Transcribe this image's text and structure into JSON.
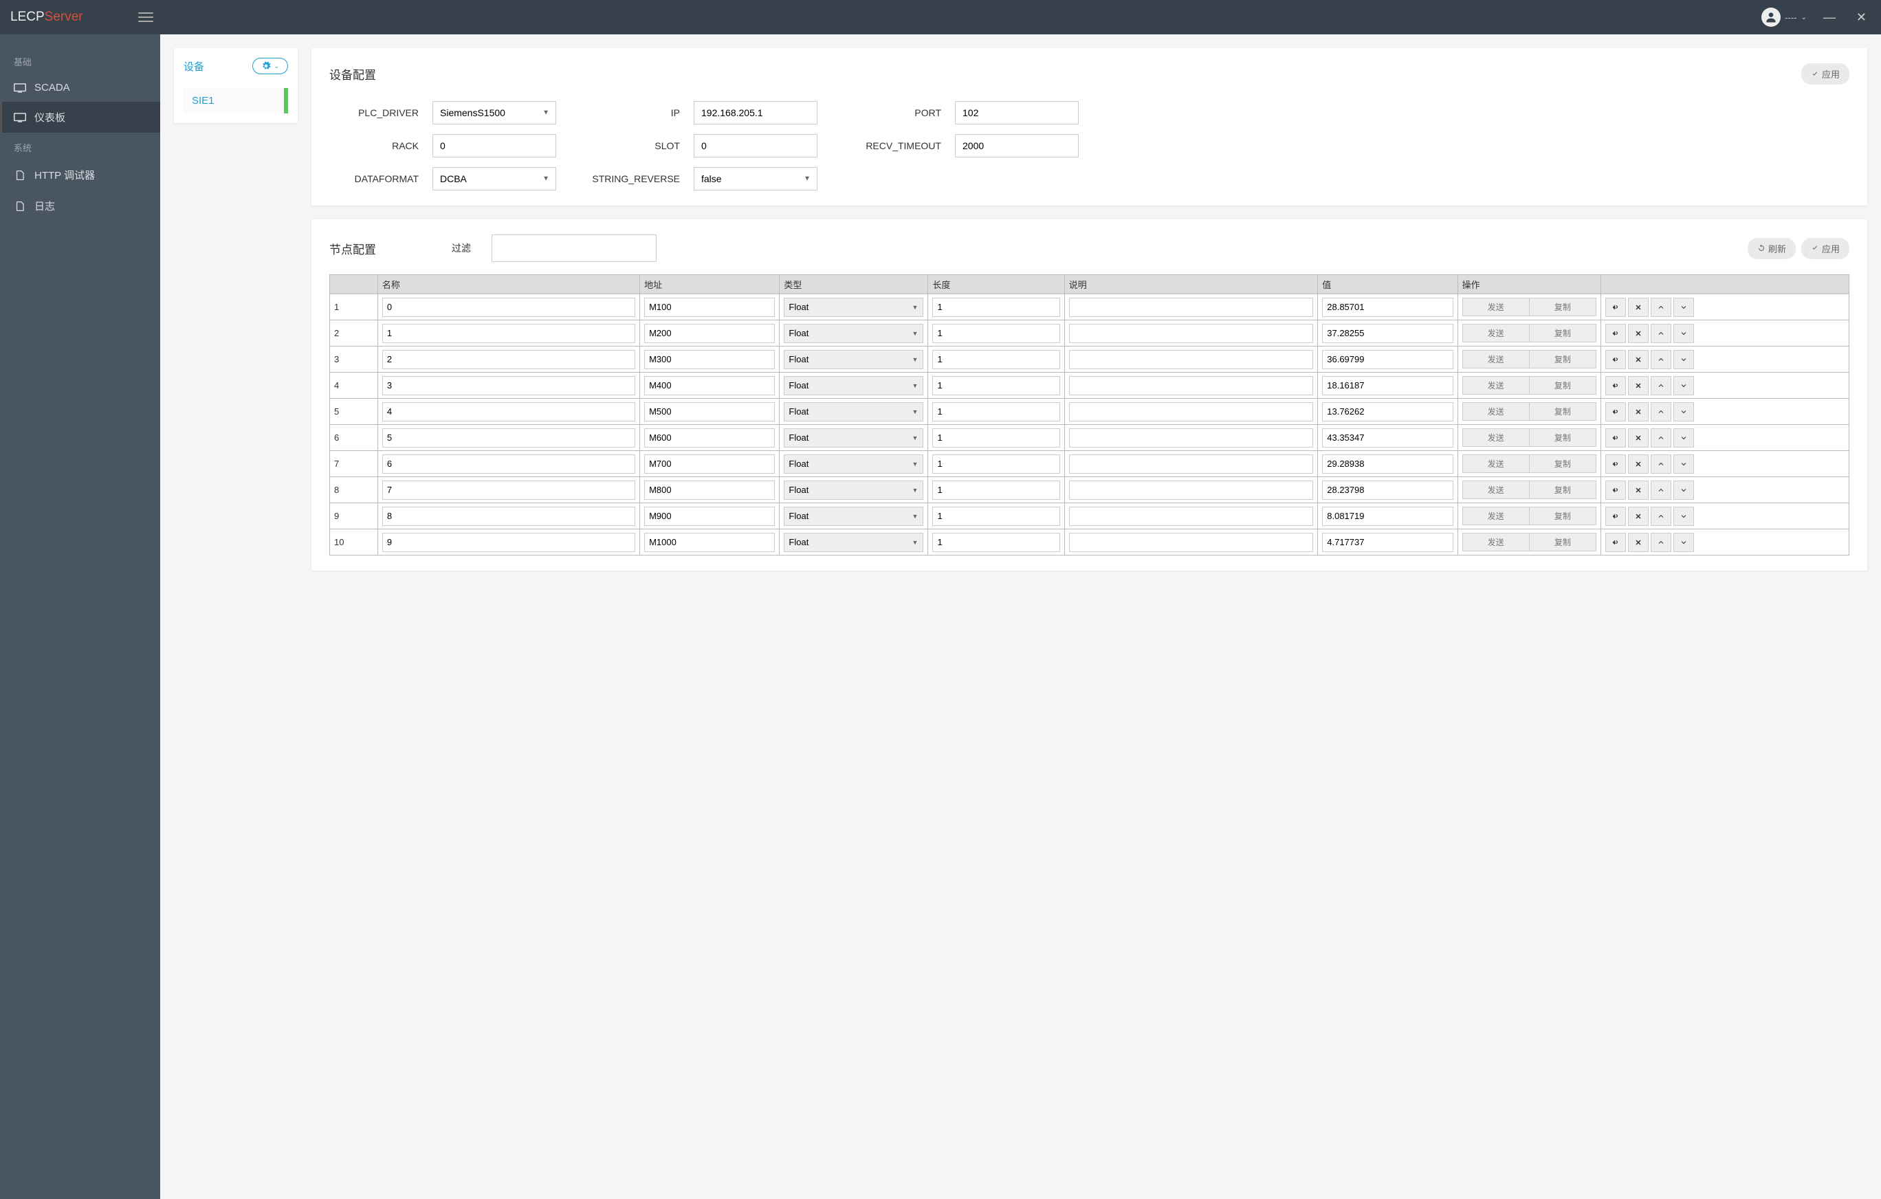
{
  "app": {
    "logo_prefix": "LECP",
    "logo_suffix": "Server",
    "user_label": "----"
  },
  "sidebar": {
    "section1": "基础",
    "section2": "系统",
    "items": [
      {
        "label": "SCADA"
      },
      {
        "label": "仪表板"
      },
      {
        "label": "HTTP 调试器"
      },
      {
        "label": "日志"
      }
    ]
  },
  "devices": {
    "title": "设备",
    "items": [
      {
        "name": "SIE1"
      }
    ]
  },
  "config": {
    "title": "设备配置",
    "apply": "应用",
    "fields": {
      "plc_driver": {
        "label": "PLC_DRIVER",
        "value": "SiemensS1500"
      },
      "ip": {
        "label": "IP",
        "value": "192.168.205.1"
      },
      "port": {
        "label": "PORT",
        "value": "102"
      },
      "rack": {
        "label": "RACK",
        "value": "0"
      },
      "slot": {
        "label": "SLOT",
        "value": "0"
      },
      "recv_timeout": {
        "label": "RECV_TIMEOUT",
        "value": "2000"
      },
      "dataformat": {
        "label": "DATAFORMAT",
        "value": "DCBA"
      },
      "string_reverse": {
        "label": "STRING_REVERSE",
        "value": "false"
      }
    }
  },
  "nodes": {
    "title": "节点配置",
    "filter_label": "过滤",
    "refresh": "刷新",
    "apply": "应用",
    "headers": {
      "name": "名称",
      "addr": "地址",
      "type": "类型",
      "len": "长度",
      "desc": "说明",
      "val": "值",
      "op": "操作"
    },
    "op_send": "发送",
    "op_copy": "复制",
    "rows": [
      {
        "idx": "1",
        "name": "0",
        "addr": "M100",
        "type": "Float",
        "len": "1",
        "desc": "",
        "val": "28.85701"
      },
      {
        "idx": "2",
        "name": "1",
        "addr": "M200",
        "type": "Float",
        "len": "1",
        "desc": "",
        "val": "37.28255"
      },
      {
        "idx": "3",
        "name": "2",
        "addr": "M300",
        "type": "Float",
        "len": "1",
        "desc": "",
        "val": "36.69799"
      },
      {
        "idx": "4",
        "name": "3",
        "addr": "M400",
        "type": "Float",
        "len": "1",
        "desc": "",
        "val": "18.16187"
      },
      {
        "idx": "5",
        "name": "4",
        "addr": "M500",
        "type": "Float",
        "len": "1",
        "desc": "",
        "val": "13.76262"
      },
      {
        "idx": "6",
        "name": "5",
        "addr": "M600",
        "type": "Float",
        "len": "1",
        "desc": "",
        "val": "43.35347"
      },
      {
        "idx": "7",
        "name": "6",
        "addr": "M700",
        "type": "Float",
        "len": "1",
        "desc": "",
        "val": "29.28938"
      },
      {
        "idx": "8",
        "name": "7",
        "addr": "M800",
        "type": "Float",
        "len": "1",
        "desc": "",
        "val": "28.23798"
      },
      {
        "idx": "9",
        "name": "8",
        "addr": "M900",
        "type": "Float",
        "len": "1",
        "desc": "",
        "val": "8.081719"
      },
      {
        "idx": "10",
        "name": "9",
        "addr": "M1000",
        "type": "Float",
        "len": "1",
        "desc": "",
        "val": "4.717737"
      }
    ]
  }
}
